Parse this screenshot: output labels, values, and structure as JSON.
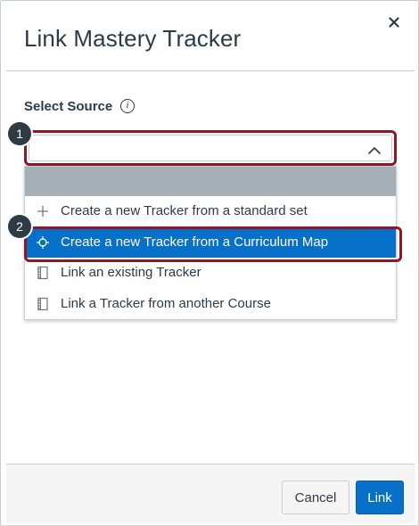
{
  "dialog": {
    "title": "Link Mastery Tracker",
    "close_icon": "close-icon"
  },
  "form": {
    "source_label": "Select Source",
    "info_icon_glyph": "i",
    "select_value": ""
  },
  "dropdown": {
    "options": [
      {
        "label": "Create a new Tracker from a standard set",
        "icon": "plus-icon",
        "highlighted": false
      },
      {
        "label": "Create a new Tracker from a Curriculum Map",
        "icon": "crosshair-icon",
        "highlighted": true
      },
      {
        "label": "Link an existing Tracker",
        "icon": "notebook-icon",
        "highlighted": false
      },
      {
        "label": "Link a Tracker from another Course",
        "icon": "notebook-icon",
        "highlighted": false
      }
    ]
  },
  "callouts": {
    "step1": "1",
    "step2": "2"
  },
  "footer": {
    "cancel_label": "Cancel",
    "link_label": "Link"
  },
  "colors": {
    "primary": "#0770c9",
    "callout_outline": "#8b1a25",
    "text": "#2d3b45"
  }
}
